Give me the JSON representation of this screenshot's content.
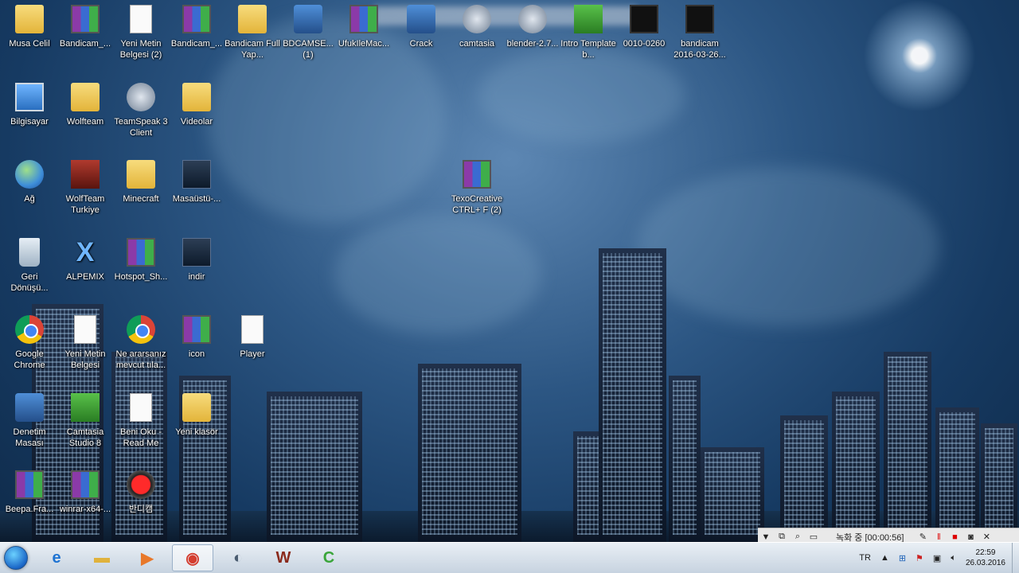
{
  "desktop": {
    "icons": [
      {
        "label": "Musa Celil",
        "icon": "user-folder-icon"
      },
      {
        "label": "Bandicam_...",
        "icon": "winrar-archive-icon"
      },
      {
        "label": "Yeni Metin Belgesi (2)",
        "icon": "text-document-icon"
      },
      {
        "label": "Bandicam_...",
        "icon": "winrar-archive-icon"
      },
      {
        "label": "Bandicam Full Yap...",
        "icon": "folder-icon"
      },
      {
        "label": "BDCAMSE... (1)",
        "icon": "installer-icon"
      },
      {
        "label": "UfukIleMac...",
        "icon": "winrar-archive-icon"
      },
      {
        "label": "Crack",
        "icon": "shield-shortcut-icon"
      },
      {
        "label": "camtasia",
        "icon": "disc-icon"
      },
      {
        "label": "blender-2.7...",
        "icon": "disc-icon"
      },
      {
        "label": "Intro Template b...",
        "icon": "green-app-icon"
      },
      {
        "label": "0010-0260",
        "icon": "video-file-icon"
      },
      {
        "label": "bandicam 2016-03-26...",
        "icon": "video-file-icon"
      },
      {
        "label": "Bilgisayar",
        "icon": "computer-icon"
      },
      {
        "label": "Wolfteam",
        "icon": "folder-icon"
      },
      {
        "label": "TeamSpeak 3 Client",
        "icon": "teamspeak-icon"
      },
      {
        "label": "Videolar",
        "icon": "video-folder-icon"
      },
      {
        "label": "Ağ",
        "icon": "network-globe-icon"
      },
      {
        "label": "WolfTeam Turkiye",
        "icon": "wolfteam-game-icon"
      },
      {
        "label": "Minecraft",
        "icon": "folder-icon"
      },
      {
        "label": "Masaüstü-...",
        "icon": "image-file-icon"
      },
      {
        "label": "TexoCreative CTRL+ F (2)",
        "icon": "winrar-archive-icon"
      },
      {
        "label": "Geri Dönüşü...",
        "icon": "recycle-bin-icon"
      },
      {
        "label": "ALPEMIX",
        "icon": "alpemix-icon"
      },
      {
        "label": "Hotspot_Sh...",
        "icon": "winrar-archive-icon"
      },
      {
        "label": "indir",
        "icon": "image-file-icon"
      },
      {
        "label": "Google Chrome",
        "icon": "chrome-icon"
      },
      {
        "label": "Yeni Metin Belgesi",
        "icon": "text-document-icon"
      },
      {
        "label": "Ne ararsanız mevcut tıla...",
        "icon": "chrome-icon"
      },
      {
        "label": "icon",
        "icon": "winrar-archive-icon"
      },
      {
        "label": "Player",
        "icon": "text-document-icon"
      },
      {
        "label": "Denetim Masası",
        "icon": "control-panel-icon"
      },
      {
        "label": "Camtasia Studio 8",
        "icon": "camtasia-icon"
      },
      {
        "label": "Beni Oku - Read Me",
        "icon": "readme-icon"
      },
      {
        "label": "Yeni klasör",
        "icon": "folder-icon"
      },
      {
        "label": "Beepa.Fra...",
        "icon": "winrar-archive-icon"
      },
      {
        "label": "winrar-x64-...",
        "icon": "winrar-installer-icon"
      },
      {
        "label": "반디캠",
        "icon": "bandicam-icon"
      }
    ]
  },
  "recorder": {
    "status": "녹화 중 [00:00:56]",
    "tools": [
      "dropdown-arrow-icon",
      "window-mode-icon",
      "zoom-icon",
      "region-icon"
    ],
    "right_tools": [
      "pencil-icon",
      "pause-icon",
      "stop-icon",
      "camera-icon"
    ],
    "close": "✕"
  },
  "taskbar": {
    "pinned": [
      {
        "name": "internet-explorer",
        "icon": "ie-icon",
        "glyph": "e",
        "color": "#1e73d2"
      },
      {
        "name": "file-explorer",
        "icon": "folder-icon",
        "glyph": "▬",
        "color": "#e0b23c"
      },
      {
        "name": "media-player",
        "icon": "media-player-icon",
        "glyph": "▶",
        "color": "#e8782a"
      },
      {
        "name": "google-chrome",
        "icon": "chrome-icon",
        "glyph": "◉",
        "color": "#d43d2f"
      },
      {
        "name": "teamspeak",
        "icon": "teamspeak-icon",
        "glyph": "◐",
        "color": "#4a5c70"
      },
      {
        "name": "wolfteam",
        "icon": "wolfteam-game-icon",
        "glyph": "W",
        "color": "#8a2a1c"
      },
      {
        "name": "camtasia",
        "icon": "camtasia-icon",
        "glyph": "C",
        "color": "#3aa53a"
      }
    ],
    "tray": {
      "language": "TR",
      "time": "22:59",
      "date": "26.03.2016"
    }
  }
}
